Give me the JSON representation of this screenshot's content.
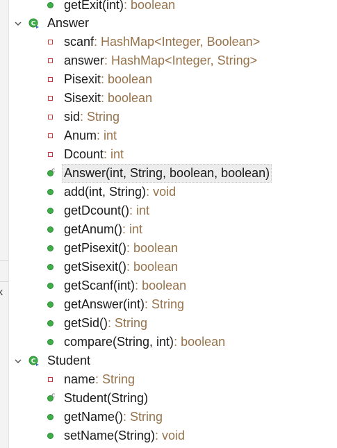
{
  "partial_top": {
    "name": "getExit(int)",
    "type": " : boolean"
  },
  "left_strip_text": "k",
  "classes": [
    {
      "name": "Answer",
      "members": [
        {
          "kind": "field",
          "name": "scanf",
          "type": " : HashMap<Integer, Boolean>"
        },
        {
          "kind": "field",
          "name": "answer",
          "type": " : HashMap<Integer, String>"
        },
        {
          "kind": "field",
          "name": "Pisexit",
          "type": " : boolean"
        },
        {
          "kind": "field",
          "name": "Sisexit",
          "type": " : boolean"
        },
        {
          "kind": "field",
          "name": "sid",
          "type": " : String"
        },
        {
          "kind": "field",
          "name": "Anum",
          "type": " : int"
        },
        {
          "kind": "field",
          "name": "Dcount",
          "type": " : int"
        },
        {
          "kind": "constructor",
          "name": "Answer(int, String, boolean, boolean)",
          "type": "",
          "selected": true
        },
        {
          "kind": "method",
          "name": "add(int, String)",
          "type": " : void"
        },
        {
          "kind": "method",
          "name": "getDcount()",
          "type": " : int"
        },
        {
          "kind": "method",
          "name": "getAnum()",
          "type": " : int"
        },
        {
          "kind": "method",
          "name": "getPisexit()",
          "type": " : boolean"
        },
        {
          "kind": "method",
          "name": "getSisexit()",
          "type": " : boolean"
        },
        {
          "kind": "method",
          "name": "getScanf(int)",
          "type": " : boolean"
        },
        {
          "kind": "method",
          "name": "getAnswer(int)",
          "type": " : String"
        },
        {
          "kind": "method",
          "name": "getSid()",
          "type": " : String"
        },
        {
          "kind": "method",
          "name": "compare(String, int)",
          "type": " : boolean"
        }
      ]
    },
    {
      "name": "Student",
      "members": [
        {
          "kind": "field",
          "name": "name",
          "type": " : String"
        },
        {
          "kind": "constructor",
          "name": "Student(String)",
          "type": ""
        },
        {
          "kind": "method",
          "name": "getName()",
          "type": " : String"
        },
        {
          "kind": "method",
          "name": "setName(String)",
          "type": " : void"
        }
      ]
    }
  ],
  "colors": {
    "method_icon": "#3fae49",
    "field_icon": "#c8353a",
    "type_text": "#97734c",
    "selection": "#ececec"
  },
  "icons": {
    "expand": "chevron-down-icon",
    "class": "class-icon",
    "field": "private-field-icon",
    "method": "public-method-icon",
    "constructor": "constructor-icon"
  }
}
